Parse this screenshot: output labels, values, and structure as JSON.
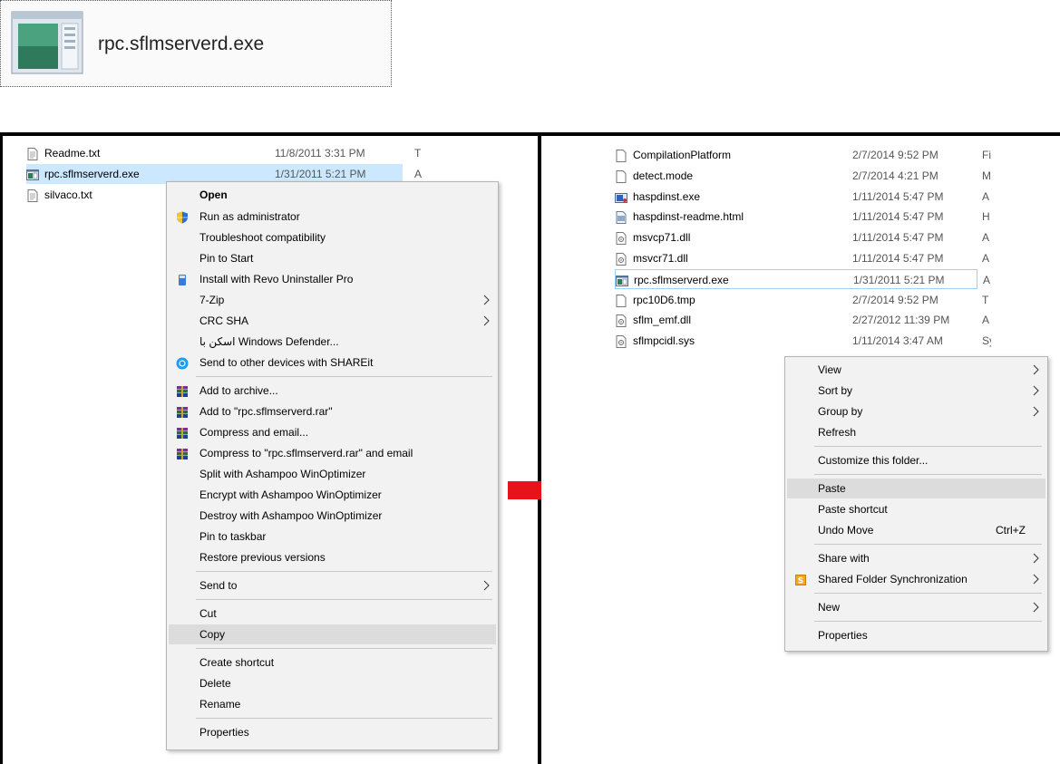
{
  "banner": {
    "title": "rpc.sflmserverd.exe"
  },
  "left": {
    "files": [
      {
        "name": "Readme.txt",
        "date": "11/8/2011 3:31 PM",
        "type": "T",
        "icon": "text-file-icon"
      },
      {
        "name": "rpc.sflmserverd.exe",
        "date": "1/31/2011 5:21 PM",
        "type": "A",
        "icon": "exe-file-icon"
      },
      {
        "name": "silvaco.txt",
        "date": "",
        "type": "",
        "icon": "text-file-icon"
      }
    ],
    "menu": {
      "items": [
        {
          "label": "Open",
          "bold": true
        },
        {
          "label": "Run as administrator",
          "icon": "uac-shield-icon"
        },
        {
          "label": "Troubleshoot compatibility"
        },
        {
          "label": "Pin to Start"
        },
        {
          "label": "Install with Revo Uninstaller Pro",
          "icon": "revo-icon"
        },
        {
          "label": "7-Zip",
          "submenu": true
        },
        {
          "label": "CRC SHA",
          "submenu": true
        },
        {
          "label": "اسکن با Windows Defender..."
        },
        {
          "label": "Send to other devices with SHAREit",
          "icon": "shareit-icon"
        },
        {
          "label": "Add to archive...",
          "icon": "winrar-icon"
        },
        {
          "label": "Add to \"rpc.sflmserverd.rar\"",
          "icon": "winrar-icon"
        },
        {
          "label": "Compress and email...",
          "icon": "winrar-icon"
        },
        {
          "label": "Compress to \"rpc.sflmserverd.rar\" and email",
          "icon": "winrar-icon"
        },
        {
          "label": "Split with Ashampoo WinOptimizer"
        },
        {
          "label": "Encrypt with Ashampoo WinOptimizer"
        },
        {
          "label": "Destroy with Ashampoo WinOptimizer"
        },
        {
          "label": "Pin to taskbar"
        },
        {
          "label": "Restore previous versions"
        },
        {
          "label": "Send to",
          "submenu": true
        },
        {
          "label": "Cut"
        },
        {
          "label": "Copy",
          "highlighted": true
        },
        {
          "label": "Create shortcut"
        },
        {
          "label": "Delete"
        },
        {
          "label": "Rename"
        },
        {
          "label": "Properties"
        }
      ]
    }
  },
  "right": {
    "files": [
      {
        "name": "CompilationPlatform",
        "date": "2/7/2014 9:52 PM",
        "type": "Fi",
        "icon": "generic-file-icon"
      },
      {
        "name": "detect.mode",
        "date": "2/7/2014 4:21 PM",
        "type": "M",
        "icon": "generic-file-icon"
      },
      {
        "name": "haspdinst.exe",
        "date": "1/11/2014 5:47 PM",
        "type": "A",
        "icon": "installer-icon"
      },
      {
        "name": "haspdinst-readme.html",
        "date": "1/11/2014 5:47 PM",
        "type": "H",
        "icon": "html-file-icon"
      },
      {
        "name": "msvcp71.dll",
        "date": "1/11/2014 5:47 PM",
        "type": "A",
        "icon": "dll-file-icon"
      },
      {
        "name": "msvcr71.dll",
        "date": "1/11/2014 5:47 PM",
        "type": "A",
        "icon": "dll-file-icon"
      },
      {
        "name": "rpc.sflmserverd.exe",
        "date": "1/31/2011 5:21 PM",
        "type": "A",
        "icon": "exe-file-icon"
      },
      {
        "name": "rpc10D6.tmp",
        "date": "2/7/2014 9:52 PM",
        "type": "T",
        "icon": "generic-file-icon"
      },
      {
        "name": "sflm_emf.dll",
        "date": "2/27/2012 11:39 PM",
        "type": "A",
        "icon": "dll-file-icon"
      },
      {
        "name": "sflmpcidl.sys",
        "date": "1/11/2014 3:47 AM",
        "type": "Sy",
        "icon": "dll-file-icon"
      }
    ],
    "menu": {
      "items": [
        {
          "label": "View",
          "submenu": true
        },
        {
          "label": "Sort by",
          "submenu": true
        },
        {
          "label": "Group by",
          "submenu": true
        },
        {
          "label": "Refresh"
        },
        {
          "label": "Customize this folder..."
        },
        {
          "label": "Paste",
          "highlighted": true
        },
        {
          "label": "Paste shortcut"
        },
        {
          "label": "Undo Move",
          "shortcut": "Ctrl+Z"
        },
        {
          "label": "Share with",
          "submenu": true
        },
        {
          "label": "Shared Folder Synchronization",
          "submenu": true,
          "icon": "sync-icon"
        },
        {
          "label": "New",
          "submenu": true
        },
        {
          "label": "Properties"
        }
      ]
    }
  },
  "colors": {
    "arrow": "#e8121b",
    "selection": "#cce8ff",
    "menu_bg": "#f2f2f2",
    "highlight": "#dcdcdc"
  }
}
